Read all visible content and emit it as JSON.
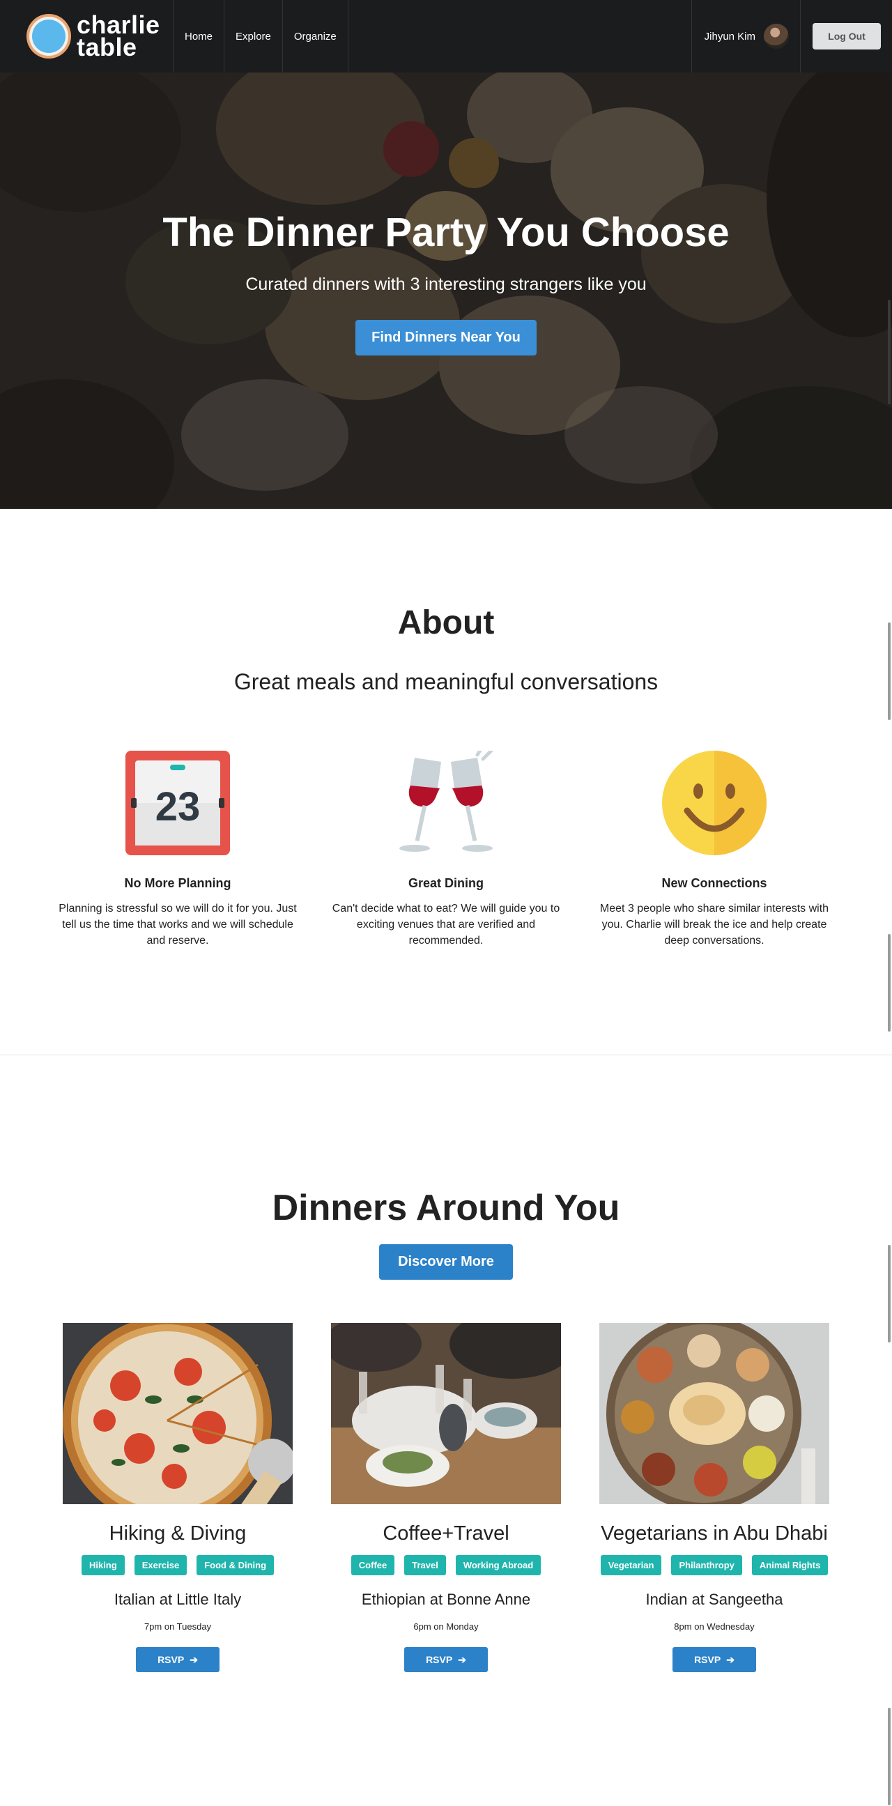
{
  "nav": {
    "brand_line1": "charlie",
    "brand_line2": "table",
    "links": [
      "Home",
      "Explore",
      "Organize"
    ],
    "user_name": "Jihyun Kim",
    "logout": "Log Out"
  },
  "hero": {
    "title": "The Dinner Party You Choose",
    "subtitle": "Curated dinners with 3 interesting strangers like you",
    "cta": "Find Dinners Near You"
  },
  "about": {
    "title": "About",
    "subtitle": "Great meals and meaningful conversations",
    "calendar_day": "23",
    "features": [
      {
        "title": "No More Planning",
        "text": "Planning is stressful so we will do it for you. Just tell us the time that works and we will schedule and reserve."
      },
      {
        "title": "Great Dining",
        "text": "Can't decide what to eat? We will guide you to exciting venues that are verified and recommended."
      },
      {
        "title": "New Connections",
        "text": "Meet 3 people who share similar interests with you. Charlie will break the ice and help create deep conversations."
      }
    ]
  },
  "dinners": {
    "title": "Dinners Around You",
    "discover": "Discover More",
    "rsvp_label": "RSVP",
    "cards": [
      {
        "title": "Hiking & Diving",
        "tags": [
          "Hiking",
          "Exercise",
          "Food & Dining"
        ],
        "venue": "Italian at Little Italy",
        "time": "7pm on Tuesday"
      },
      {
        "title": "Coffee+Travel",
        "tags": [
          "Coffee",
          "Travel",
          "Working Abroad"
        ],
        "venue": "Ethiopian at Bonne Anne",
        "time": "6pm on Monday"
      },
      {
        "title": "Vegetarians in Abu Dhabi",
        "tags": [
          "Vegetarian",
          "Philanthropy",
          "Animal Rights"
        ],
        "venue": "Indian at Sangeetha",
        "time": "8pm on Wednesday"
      }
    ]
  },
  "colors": {
    "nav_bg": "#1b1c1d",
    "primary_button": "#2c82c9",
    "tag": "#1fb5ac"
  }
}
